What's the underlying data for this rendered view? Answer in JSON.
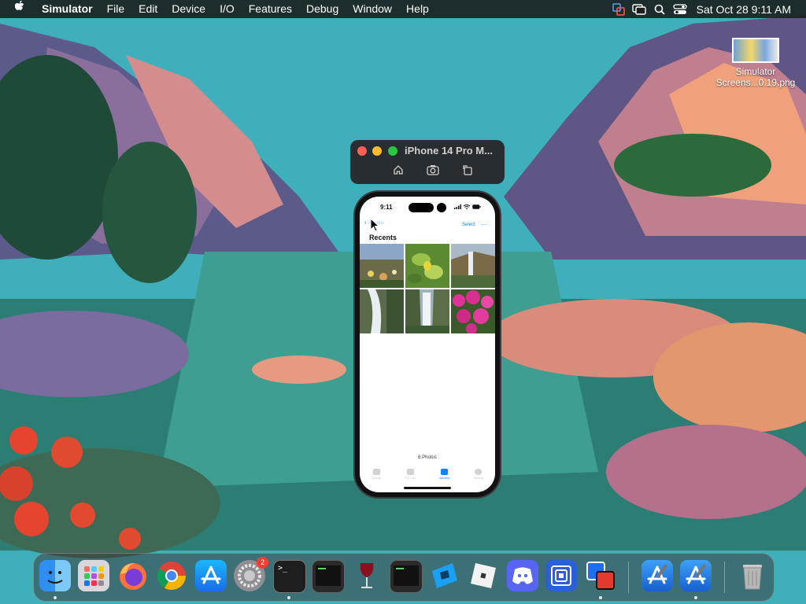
{
  "menubar": {
    "app_name": "Simulator",
    "items": [
      "File",
      "Edit",
      "Device",
      "I/O",
      "Features",
      "Debug",
      "Window",
      "Help"
    ],
    "clock": "Sat Oct 28  9:11 AM"
  },
  "desktop_file": {
    "name_line1": "Simulator",
    "name_line2": "Screens...0.19.png"
  },
  "simulator_window": {
    "title": "iPhone 14 Pro M..."
  },
  "phone": {
    "time": "9:11",
    "back_label": "Albums",
    "select_label": "Select",
    "more_label": "···",
    "title": "Recents",
    "photo_count": "6 Photos",
    "tabs": [
      "Library",
      "For You",
      "Albums",
      "Search"
    ]
  },
  "dock": {
    "settings_badge": "2",
    "terminal_prompt": ">_"
  },
  "colors": {
    "accent": "#0a84ff",
    "badge": "#ff3b30"
  }
}
